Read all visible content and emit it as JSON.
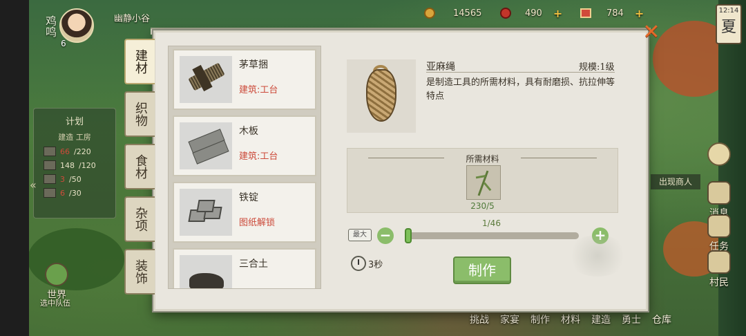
{
  "hud": {
    "chick_label": "鸡鸣",
    "player_level": "6",
    "village_name": "幽静小谷",
    "coins": "14565",
    "gems": "490",
    "tickets": "784",
    "time": "12:14",
    "season": "夏"
  },
  "plan": {
    "title": "计划",
    "subtitle": "建造 工房",
    "rows": [
      {
        "have": "66",
        "need": "/220",
        "have_color": "#d04a3a"
      },
      {
        "have": "148",
        "need": "/120",
        "have_color": "#e8e2c6"
      },
      {
        "have": "3",
        "need": "/50",
        "have_color": "#d04a3a"
      },
      {
        "have": "6",
        "need": "/30",
        "have_color": "#d04a3a"
      }
    ]
  },
  "side_buttons": {
    "merchant": "出现商人",
    "message": "消息",
    "task": "任务",
    "villager": "村民",
    "world": "世界",
    "team": "选中队伍"
  },
  "bottom_bar": [
    "挑战",
    "家宴",
    "制作",
    "材料",
    "建造",
    "勇士",
    "仓库"
  ],
  "tabs": [
    {
      "label": "建材",
      "active": true
    },
    {
      "label": "织物",
      "active": false
    },
    {
      "label": "食材",
      "active": false
    },
    {
      "label": "杂项",
      "active": false
    },
    {
      "label": "装饰",
      "active": false
    }
  ],
  "items": [
    {
      "name": "茅草捆",
      "req": "建筑:工台",
      "icon": "hay-bundle-icon"
    },
    {
      "name": "木板",
      "req": "建筑:工台",
      "icon": "wood-plank-icon"
    },
    {
      "name": "铁锭",
      "req": "图纸解锁",
      "icon": "iron-ingot-icon"
    },
    {
      "name": "三合土",
      "req": "",
      "icon": "clay-icon"
    }
  ],
  "detail": {
    "name": "亚麻绳",
    "spec": "规模:1级",
    "description": "是制造工具的所需材料，具有耐磨损、抗拉伸等特点",
    "req_title": "所需材料",
    "req_material_icon": "flax-icon",
    "req_count": "230/5",
    "quantity": "1/46",
    "quantity_fraction": 0.02,
    "max_label": "最大",
    "time": "3秒",
    "make_label": "制作"
  },
  "colors": {
    "accent_green": "#8bbd6a",
    "close_orange": "#e46a2a",
    "warning_red": "#cc4a3a"
  }
}
